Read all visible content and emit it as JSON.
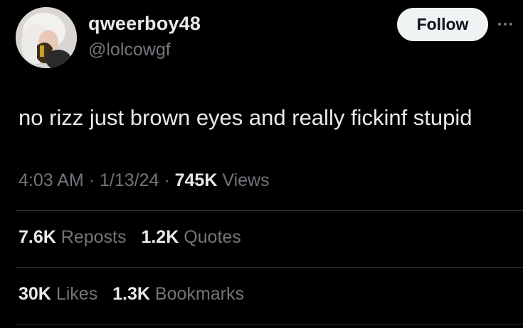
{
  "user": {
    "display_name": "qweerboy48",
    "handle": "@lolcowgf"
  },
  "header": {
    "follow_label": "Follow",
    "more_icon": "more-horizontal-icon"
  },
  "tweet": {
    "text": "no rizz just brown eyes and really fickinf stupid"
  },
  "meta": {
    "time": "4:03 AM",
    "separator": "·",
    "date": "1/13/24",
    "views_count": "745K",
    "views_label": "Views"
  },
  "stats": {
    "reposts_count": "7.6K",
    "reposts_label": "Reposts",
    "quotes_count": "1.2K",
    "quotes_label": "Quotes",
    "likes_count": "30K",
    "likes_label": "Likes",
    "bookmarks_count": "1.3K",
    "bookmarks_label": "Bookmarks"
  },
  "colors": {
    "background": "#000000",
    "primary_text": "#e7e9ea",
    "secondary_text": "#71767b",
    "divider": "#2f3336",
    "follow_button_bg": "#eff3f4"
  }
}
